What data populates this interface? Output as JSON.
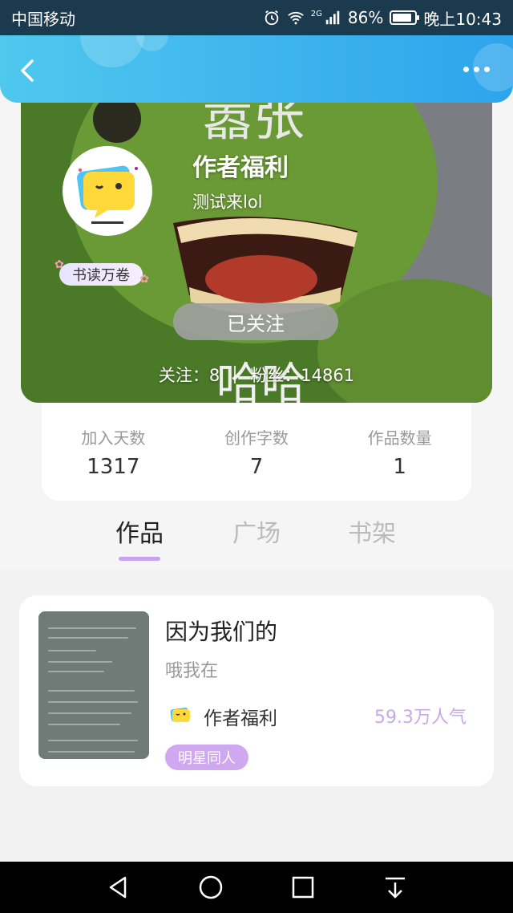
{
  "status_bar": {
    "carrier": "中国移动",
    "network": "2G",
    "battery": "86%",
    "battery_level": 0.86,
    "time": "晚上10:43"
  },
  "header": {
    "back_icon": "chevron-left-icon",
    "more_icon": "more-horizontal-icon",
    "gradient": [
      "#4fc8ee",
      "#2ea4ec"
    ]
  },
  "profile": {
    "name": "作者福利",
    "signature": "测试来lol",
    "badge": "书读万卷",
    "follow_button": "已关注",
    "following_label": "关注：",
    "following_count": "8",
    "fans_label": "粉丝：",
    "fans_count": "14861",
    "cover_text": [
      "嚣张",
      "哈哈"
    ]
  },
  "stats": [
    {
      "label": "加入天数",
      "value": "1317"
    },
    {
      "label": "创作字数",
      "value": "7"
    },
    {
      "label": "作品数量",
      "value": "1"
    }
  ],
  "tabs": [
    {
      "label": "作品",
      "active": true
    },
    {
      "label": "广场",
      "active": false
    },
    {
      "label": "书架",
      "active": false
    }
  ],
  "book": {
    "title": "因为我们的",
    "description": "哦我在",
    "author": "作者福利",
    "popularity": "59.3万人气",
    "tag": "明星同人",
    "tag_color": "#cfa8ef"
  },
  "nav_bar": {
    "icons": [
      "back-triangle-icon",
      "home-circle-icon",
      "recents-square-icon",
      "notification-pull-icon"
    ]
  }
}
